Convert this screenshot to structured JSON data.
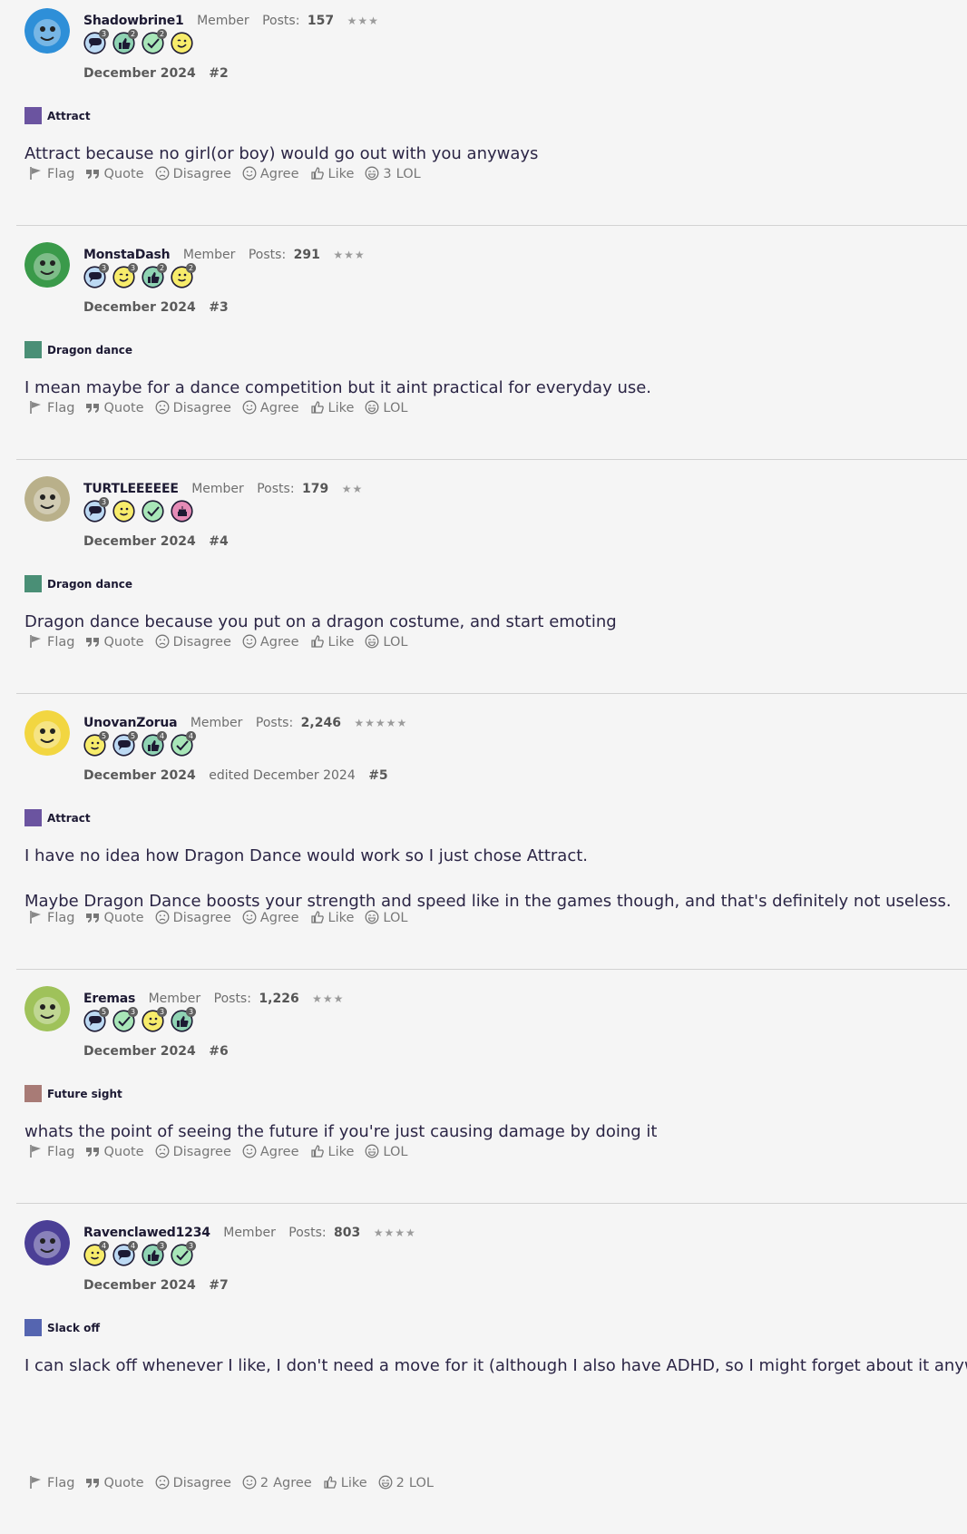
{
  "actions": {
    "flag": "Flag",
    "quote": "Quote",
    "disagree": "Disagree",
    "agree": "Agree",
    "like": "Like",
    "lol": "LOL"
  },
  "posts": [
    {
      "username": "Shadowbrine1",
      "role": "Member",
      "posts_label": "Posts:",
      "posts_count": "157",
      "stars": "★★★",
      "date": "December 2024",
      "edited": "",
      "post_number": "#2",
      "tag": {
        "label": "Attract",
        "color": "#6b54a0"
      },
      "body": [
        "Attract because no girl(or boy) would go out with you anyways"
      ],
      "badges": [
        {
          "icon": "comment-badge-icon",
          "count": "3"
        },
        {
          "icon": "thumbs-up-badge-icon",
          "count": "2"
        },
        {
          "icon": "check-badge-icon",
          "count": "2"
        },
        {
          "icon": "wink-badge-icon",
          "count": ""
        }
      ],
      "counts": {
        "agree": "",
        "lol": "3"
      },
      "avatar_color": "#2e8fd8"
    },
    {
      "username": "MonstaDash",
      "role": "Member",
      "posts_label": "Posts:",
      "posts_count": "291",
      "stars": "★★★",
      "date": "December 2024",
      "edited": "",
      "post_number": "#3",
      "tag": {
        "label": "Dragon dance",
        "color": "#4a8f76"
      },
      "body": [
        "I mean maybe for a dance competition but it aint practical for everyday use."
      ],
      "badges": [
        {
          "icon": "comment-badge-icon",
          "count": "3"
        },
        {
          "icon": "wink-badge-icon",
          "count": "3"
        },
        {
          "icon": "thumbs-up-badge-icon",
          "count": "2"
        },
        {
          "icon": "smile-badge-icon",
          "count": "2"
        }
      ],
      "counts": {
        "agree": "",
        "lol": ""
      },
      "avatar_color": "#3a9a4a"
    },
    {
      "username": "TURTLEEEEEE",
      "role": "Member",
      "posts_label": "Posts:",
      "posts_count": "179",
      "stars": "★★",
      "date": "December 2024",
      "edited": "",
      "post_number": "#4",
      "tag": {
        "label": "Dragon dance",
        "color": "#4a8f76"
      },
      "body": [
        "Dragon dance because you put on a dragon costume, and start emoting"
      ],
      "badges": [
        {
          "icon": "comment-badge-icon",
          "count": "3"
        },
        {
          "icon": "smile-badge-icon",
          "count": ""
        },
        {
          "icon": "check-badge-icon",
          "count": ""
        },
        {
          "icon": "cake-badge-icon",
          "count": ""
        }
      ],
      "counts": {
        "agree": "",
        "lol": ""
      },
      "avatar_color": "#b9b08a"
    },
    {
      "username": "UnovanZorua",
      "role": "Member",
      "posts_label": "Posts:",
      "posts_count": "2,246",
      "stars": "★★★★★",
      "date": "December 2024",
      "edited": "edited December 2024",
      "post_number": "#5",
      "tag": {
        "label": "Attract",
        "color": "#6b54a0"
      },
      "body": [
        "I have no idea how Dragon Dance would work so I just chose Attract.",
        "Maybe Dragon Dance boosts your strength and speed like in the games though, and that's definitely not useless."
      ],
      "badges": [
        {
          "icon": "smile-badge-icon",
          "count": "5"
        },
        {
          "icon": "comment-badge-icon",
          "count": "5"
        },
        {
          "icon": "thumbs-up-badge-icon",
          "count": "4"
        },
        {
          "icon": "check-badge-icon",
          "count": "4"
        }
      ],
      "counts": {
        "agree": "",
        "lol": ""
      },
      "avatar_color": "#f2d641"
    },
    {
      "username": "Eremas",
      "role": "Member",
      "posts_label": "Posts:",
      "posts_count": "1,226",
      "stars": "★★★",
      "date": "December 2024",
      "edited": "",
      "post_number": "#6",
      "tag": {
        "label": "Future sight",
        "color": "#a87b76"
      },
      "body": [
        "whats the point of seeing the future if you're just causing damage by doing it"
      ],
      "badges": [
        {
          "icon": "comment-badge-icon",
          "count": "5"
        },
        {
          "icon": "check-badge-icon",
          "count": "3"
        },
        {
          "icon": "smile-badge-icon",
          "count": "3"
        },
        {
          "icon": "thumbs-up-badge-icon",
          "count": "3"
        }
      ],
      "counts": {
        "agree": "",
        "lol": ""
      },
      "avatar_color": "#9fc25a"
    },
    {
      "username": "Ravenclawed1234",
      "role": "Member",
      "posts_label": "Posts:",
      "posts_count": "803",
      "stars": "★★★★",
      "date": "December 2024",
      "edited": "",
      "post_number": "#7",
      "tag": {
        "label": "Slack off",
        "color": "#5565b0"
      },
      "body": [
        "I can slack off whenever I like, I don't need a move for it (although I also have ADHD, so I might forget about it anyway)"
      ],
      "badges": [
        {
          "icon": "smile-badge-icon",
          "count": "4"
        },
        {
          "icon": "comment-badge-icon",
          "count": "4"
        },
        {
          "icon": "thumbs-up-badge-icon",
          "count": "3"
        },
        {
          "icon": "check-badge-icon",
          "count": "3"
        }
      ],
      "counts": {
        "agree": "2",
        "lol": "2"
      },
      "avatar_color": "#4b3f96"
    }
  ]
}
